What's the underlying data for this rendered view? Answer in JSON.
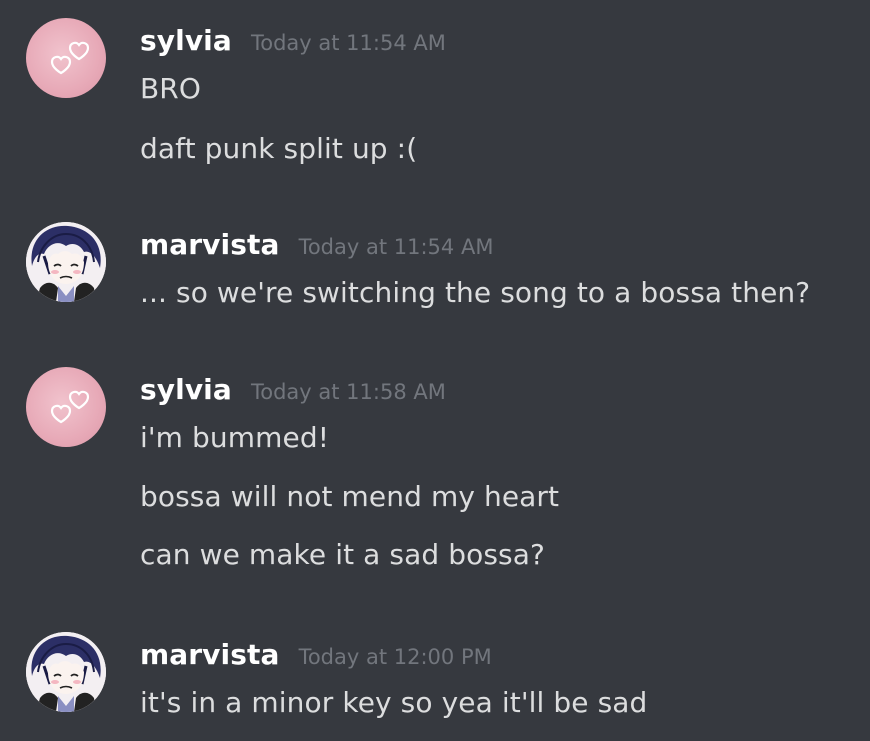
{
  "messages": [
    {
      "username": "sylvia",
      "timestamp": "Today at 11:54 AM",
      "avatar": "pink-hearts-icon",
      "lines": [
        "BRO",
        "daft punk split up :("
      ]
    },
    {
      "username": "marvista",
      "timestamp": "Today at 11:54 AM",
      "avatar": "anime-character-avatar",
      "lines": [
        "... so we're switching the song to a bossa then?"
      ]
    },
    {
      "username": "sylvia",
      "timestamp": "Today at 11:58 AM",
      "avatar": "pink-hearts-icon",
      "lines": [
        "i'm bummed!",
        "bossa will not mend my heart",
        "can we make it a sad bossa?"
      ]
    },
    {
      "username": "marvista",
      "timestamp": "Today at 12:00 PM",
      "avatar": "anime-character-avatar",
      "lines": [
        "it's in a minor key so yea it'll be sad"
      ]
    }
  ],
  "colors": {
    "background": "#36393f",
    "username": "#ffffff",
    "text": "#dcddde",
    "timestamp": "#72767d",
    "avatar_pink": "#e7a9b7"
  }
}
